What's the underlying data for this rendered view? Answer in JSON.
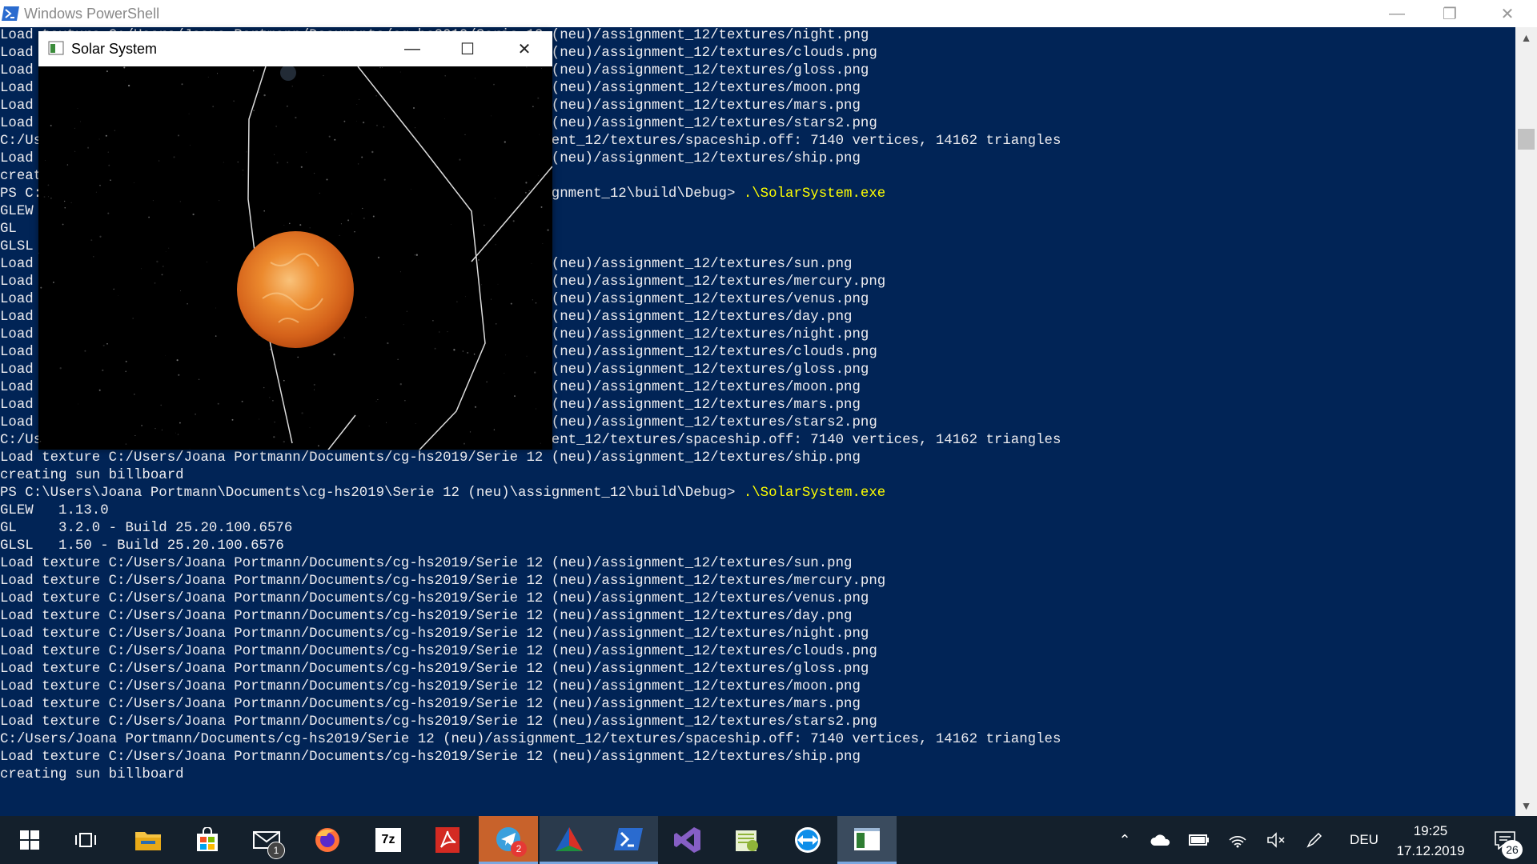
{
  "powershell": {
    "title": "Windows PowerShell",
    "minimize": "—",
    "restore": "❐",
    "close": "✕",
    "lines": [
      {
        "t": "Load texture C:/Users/Joana Portmann/Documents/cg-hs2019/Serie 12 (neu)/assignment_12/textures/night.png"
      },
      {
        "t": "Load texture C:/Users/Joana Portmann/Documents/cg-hs2019/Serie 12 (neu)/assignment_12/textures/clouds.png"
      },
      {
        "t": "Load texture C:/Users/Joana Portmann/Documents/cg-hs2019/Serie 12 (neu)/assignment_12/textures/gloss.png"
      },
      {
        "t": "Load texture C:/Users/Joana Portmann/Documents/cg-hs2019/Serie 12 (neu)/assignment_12/textures/moon.png"
      },
      {
        "t": "Load texture C:/Users/Joana Portmann/Documents/cg-hs2019/Serie 12 (neu)/assignment_12/textures/mars.png"
      },
      {
        "t": "Load texture C:/Users/Joana Portmann/Documents/cg-hs2019/Serie 12 (neu)/assignment_12/textures/stars2.png"
      },
      {
        "t": "C:/Users/Joana Portmann/Documents/cg-hs2019/Serie 12 (neu)/assignment_12/textures/spaceship.off: 7140 vertices, 14162 triangles"
      },
      {
        "t": "Load texture C:/Users/Joana Portmann/Documents/cg-hs2019/Serie 12 (neu)/assignment_12/textures/ship.png"
      },
      {
        "t": "creating sun billboard"
      },
      {
        "t": "PS C:\\Users\\Joana Portmann\\Documents\\cg-hs2019\\Serie 12 (neu)\\assignment_12\\build\\Debug> ",
        "cmd": ".\\SolarSystem.exe"
      },
      {
        "t": "GLEW   1.13.0"
      },
      {
        "t": "GL     3.2.0 - Build 25.20.100.6576"
      },
      {
        "t": "GLSL   1.50 - Build 25.20.100.6576"
      },
      {
        "t": "Load texture C:/Users/Joana Portmann/Documents/cg-hs2019/Serie 12 (neu)/assignment_12/textures/sun.png"
      },
      {
        "t": "Load texture C:/Users/Joana Portmann/Documents/cg-hs2019/Serie 12 (neu)/assignment_12/textures/mercury.png"
      },
      {
        "t": "Load texture C:/Users/Joana Portmann/Documents/cg-hs2019/Serie 12 (neu)/assignment_12/textures/venus.png"
      },
      {
        "t": "Load texture C:/Users/Joana Portmann/Documents/cg-hs2019/Serie 12 (neu)/assignment_12/textures/day.png"
      },
      {
        "t": "Load texture C:/Users/Joana Portmann/Documents/cg-hs2019/Serie 12 (neu)/assignment_12/textures/night.png"
      },
      {
        "t": "Load texture C:/Users/Joana Portmann/Documents/cg-hs2019/Serie 12 (neu)/assignment_12/textures/clouds.png"
      },
      {
        "t": "Load texture C:/Users/Joana Portmann/Documents/cg-hs2019/Serie 12 (neu)/assignment_12/textures/gloss.png"
      },
      {
        "t": "Load texture C:/Users/Joana Portmann/Documents/cg-hs2019/Serie 12 (neu)/assignment_12/textures/moon.png"
      },
      {
        "t": "Load texture C:/Users/Joana Portmann/Documents/cg-hs2019/Serie 12 (neu)/assignment_12/textures/mars.png"
      },
      {
        "t": "Load texture C:/Users/Joana Portmann/Documents/cg-hs2019/Serie 12 (neu)/assignment_12/textures/stars2.png"
      },
      {
        "t": "C:/Users/Joana Portmann/Documents/cg-hs2019/Serie 12 (neu)/assignment_12/textures/spaceship.off: 7140 vertices, 14162 triangles"
      },
      {
        "t": "Load texture C:/Users/Joana Portmann/Documents/cg-hs2019/Serie 12 (neu)/assignment_12/textures/ship.png"
      },
      {
        "t": "creating sun billboard"
      },
      {
        "t": "PS C:\\Users\\Joana Portmann\\Documents\\cg-hs2019\\Serie 12 (neu)\\assignment_12\\build\\Debug> ",
        "cmd": ".\\SolarSystem.exe"
      },
      {
        "t": "GLEW   1.13.0"
      },
      {
        "t": "GL     3.2.0 - Build 25.20.100.6576"
      },
      {
        "t": "GLSL   1.50 - Build 25.20.100.6576"
      },
      {
        "t": "Load texture C:/Users/Joana Portmann/Documents/cg-hs2019/Serie 12 (neu)/assignment_12/textures/sun.png"
      },
      {
        "t": "Load texture C:/Users/Joana Portmann/Documents/cg-hs2019/Serie 12 (neu)/assignment_12/textures/mercury.png"
      },
      {
        "t": "Load texture C:/Users/Joana Portmann/Documents/cg-hs2019/Serie 12 (neu)/assignment_12/textures/venus.png"
      },
      {
        "t": "Load texture C:/Users/Joana Portmann/Documents/cg-hs2019/Serie 12 (neu)/assignment_12/textures/day.png"
      },
      {
        "t": "Load texture C:/Users/Joana Portmann/Documents/cg-hs2019/Serie 12 (neu)/assignment_12/textures/night.png"
      },
      {
        "t": "Load texture C:/Users/Joana Portmann/Documents/cg-hs2019/Serie 12 (neu)/assignment_12/textures/clouds.png"
      },
      {
        "t": "Load texture C:/Users/Joana Portmann/Documents/cg-hs2019/Serie 12 (neu)/assignment_12/textures/gloss.png"
      },
      {
        "t": "Load texture C:/Users/Joana Portmann/Documents/cg-hs2019/Serie 12 (neu)/assignment_12/textures/moon.png"
      },
      {
        "t": "Load texture C:/Users/Joana Portmann/Documents/cg-hs2019/Serie 12 (neu)/assignment_12/textures/mars.png"
      },
      {
        "t": "Load texture C:/Users/Joana Portmann/Documents/cg-hs2019/Serie 12 (neu)/assignment_12/textures/stars2.png"
      },
      {
        "t": "C:/Users/Joana Portmann/Documents/cg-hs2019/Serie 12 (neu)/assignment_12/textures/spaceship.off: 7140 vertices, 14162 triangles"
      },
      {
        "t": "Load texture C:/Users/Joana Portmann/Documents/cg-hs2019/Serie 12 (neu)/assignment_12/textures/ship.png"
      },
      {
        "t": "creating sun billboard"
      }
    ]
  },
  "solar_window": {
    "title": "Solar System",
    "minimize": "—",
    "maximize": "☐",
    "close": "✕"
  },
  "taskbar": {
    "apps": [
      {
        "name": "start-button",
        "icon": "windows-icon"
      },
      {
        "name": "task-view-button",
        "icon": "task-view-icon"
      },
      {
        "name": "file-explorer-button",
        "icon": "folder-icon"
      },
      {
        "name": "store-button",
        "icon": "store-icon"
      },
      {
        "name": "mail-button",
        "icon": "mail-icon",
        "badge": "1"
      },
      {
        "name": "firefox-button",
        "icon": "firefox-icon"
      },
      {
        "name": "7zip-button",
        "icon": "7zip-icon",
        "label": "7z"
      },
      {
        "name": "acrobat-button",
        "icon": "acrobat-icon"
      },
      {
        "name": "telegram-button",
        "icon": "telegram-icon",
        "badge": "2"
      },
      {
        "name": "app-triangle-button",
        "icon": "triangle-app-icon"
      },
      {
        "name": "powershell-button",
        "icon": "powershell-icon"
      },
      {
        "name": "visual-studio-button",
        "icon": "visual-studio-icon"
      },
      {
        "name": "notepadpp-button",
        "icon": "notepad-icon"
      },
      {
        "name": "teamviewer-button",
        "icon": "teamviewer-icon"
      },
      {
        "name": "solar-system-app-button",
        "icon": "app-window-icon"
      }
    ],
    "language": "DEU",
    "time": "19:25",
    "date": "17.12.2019",
    "notifications": "26"
  },
  "colors": {
    "terminal_bg": "#012456",
    "terminal_text": "#eeedf0",
    "command": "#ffff00",
    "taskbar": "#14202c"
  }
}
